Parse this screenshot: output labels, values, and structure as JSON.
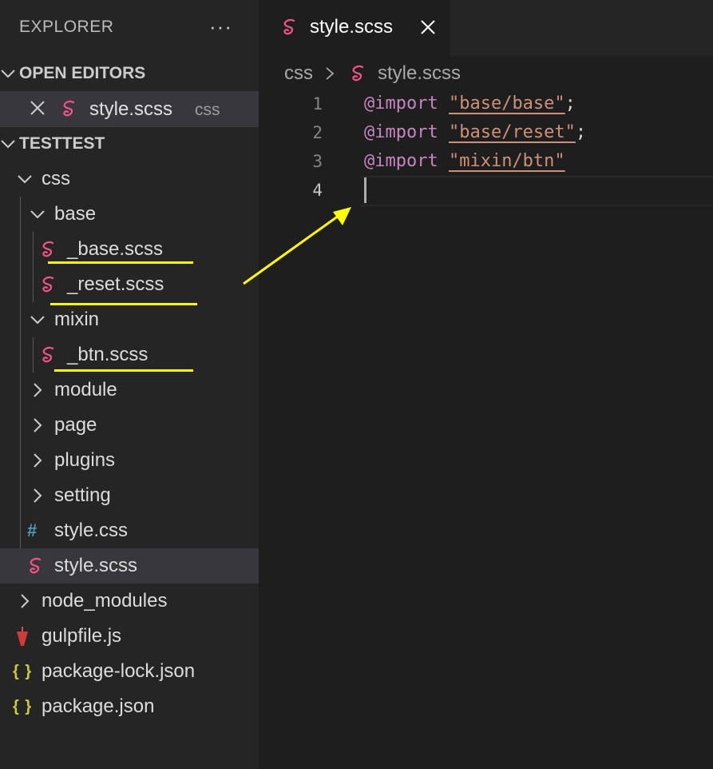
{
  "sidebar": {
    "title": "EXPLORER",
    "more_label": "···",
    "open_editors": {
      "label": "OPEN EDITORS",
      "items": [
        {
          "name": "style.scss",
          "description": "css"
        }
      ]
    },
    "workspace": {
      "label": "TESTTEST",
      "tree": [
        {
          "name": "css",
          "type": "folder",
          "expanded": true
        },
        {
          "name": "base",
          "type": "folder",
          "expanded": true
        },
        {
          "name": "_base.scss",
          "type": "sass"
        },
        {
          "name": "_reset.scss",
          "type": "sass"
        },
        {
          "name": "mixin",
          "type": "folder",
          "expanded": true
        },
        {
          "name": "_btn.scss",
          "type": "sass"
        },
        {
          "name": "module",
          "type": "folder",
          "expanded": false
        },
        {
          "name": "page",
          "type": "folder",
          "expanded": false
        },
        {
          "name": "plugins",
          "type": "folder",
          "expanded": false
        },
        {
          "name": "setting",
          "type": "folder",
          "expanded": false
        },
        {
          "name": "style.css",
          "type": "css"
        },
        {
          "name": "style.scss",
          "type": "sass",
          "selected": true
        },
        {
          "name": "node_modules",
          "type": "folder",
          "expanded": false
        },
        {
          "name": "gulpfile.js",
          "type": "gulp"
        },
        {
          "name": "package-lock.json",
          "type": "json"
        },
        {
          "name": "package.json",
          "type": "json"
        }
      ]
    }
  },
  "icons": {
    "sass": "sass-icon",
    "css": "hash-icon",
    "json": "json-braces-icon",
    "gulp": "gulp-cup-icon",
    "css_glyph": "#",
    "json_glyph": "{ }"
  },
  "editor": {
    "tab": {
      "label": "style.scss"
    },
    "breadcrumb": [
      "css",
      "style.scss"
    ],
    "active_line": 4,
    "lines": [
      {
        "number": "1",
        "keyword": "@import",
        "string": "\"base/base\"",
        "terminator": ";"
      },
      {
        "number": "2",
        "keyword": "@import",
        "string": "\"base/reset\"",
        "terminator": ";"
      },
      {
        "number": "3",
        "keyword": "@import",
        "string": "\"mixin/btn\"",
        "terminator": ""
      },
      {
        "number": "4",
        "keyword": "",
        "string": "",
        "terminator": ""
      }
    ]
  },
  "colors": {
    "sidebar_bg": "#252526",
    "editor_bg": "#1e1e1e",
    "selection_bg": "#37373d",
    "sass_pink": "#f55385",
    "keyword": "#c586c0",
    "string": "#ce9178",
    "annotation_yellow": "#ffff00"
  }
}
